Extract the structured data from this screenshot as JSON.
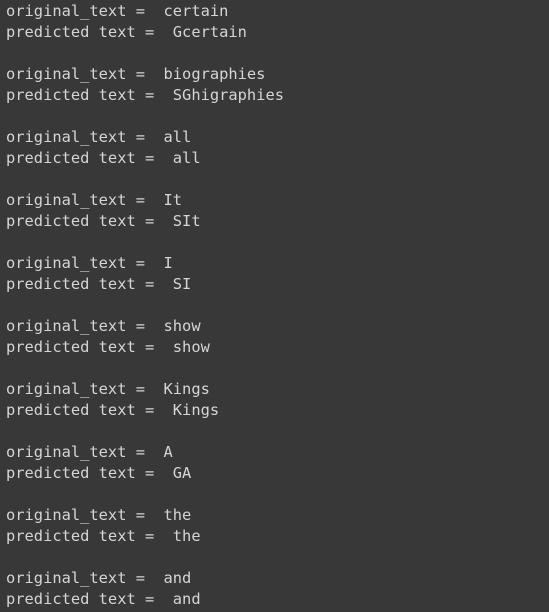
{
  "output": {
    "pairs": [
      {
        "original": "original_text =  certain",
        "predicted": "predicted text =  Gcertain"
      },
      {
        "original": "original_text =  biographies",
        "predicted": "predicted text =  SGhigraphies"
      },
      {
        "original": "original_text =  all",
        "predicted": "predicted text =  all"
      },
      {
        "original": "original_text =  It",
        "predicted": "predicted text =  SIt"
      },
      {
        "original": "original_text =  I",
        "predicted": "predicted text =  SI"
      },
      {
        "original": "original_text =  show",
        "predicted": "predicted text =  show"
      },
      {
        "original": "original_text =  Kings",
        "predicted": "predicted text =  Kings"
      },
      {
        "original": "original_text =  A",
        "predicted": "predicted text =  GA"
      },
      {
        "original": "original_text =  the",
        "predicted": "predicted text =  the"
      },
      {
        "original": "original_text =  and",
        "predicted": "predicted text =  and"
      }
    ]
  },
  "colors": {
    "background": "#383838",
    "text": "#d5d5d5"
  }
}
